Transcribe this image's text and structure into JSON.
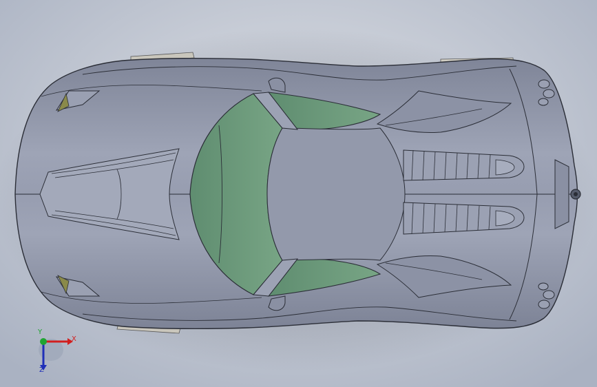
{
  "viewport": {
    "background_top": "#d7dbe2",
    "background_bottom": "#aab2c2"
  },
  "model": {
    "body_color": "#8f95a8",
    "glass_color": "#6b987a",
    "edge_color": "#2a2d36"
  },
  "triad": {
    "x_label": "X",
    "y_label": "Y",
    "z_label": "Z",
    "x_color": "#d21f1f",
    "y_color": "#1fa531",
    "z_color": "#1f2fb8"
  }
}
